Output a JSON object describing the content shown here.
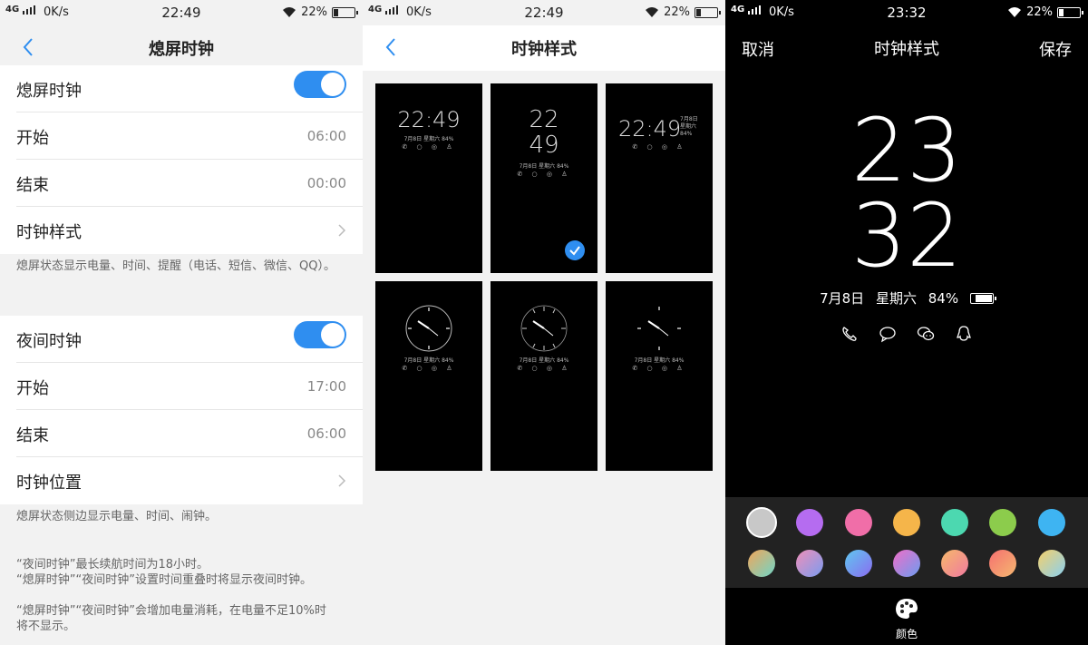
{
  "screens": [
    {
      "status": {
        "network": "4G",
        "speed": "0K/s",
        "time": "22:49",
        "battery": "22%"
      },
      "title": "熄屏时钟",
      "group1": [
        {
          "label": "熄屏时钟",
          "type": "toggle",
          "on": true
        },
        {
          "label": "开始",
          "value": "06:00"
        },
        {
          "label": "结束",
          "value": "00:00"
        },
        {
          "label": "时钟样式",
          "type": "link"
        }
      ],
      "note1": "熄屏状态显示电量、时间、提醒（电话、短信、微信、QQ）。",
      "group2": [
        {
          "label": "夜间时钟",
          "type": "toggle",
          "on": true
        },
        {
          "label": "开始",
          "value": "17:00"
        },
        {
          "label": "结束",
          "value": "06:00"
        },
        {
          "label": "时钟位置",
          "type": "link"
        }
      ],
      "note2": "熄屏状态侧边显示电量、时间、闹钟。",
      "footnotes": [
        "“夜间时钟”最长续航时间为18小时。",
        "“熄屏时钟”“夜间时钟”设置时间重叠时将显示夜间时钟。",
        "“熄屏时钟”“夜间时钟”会增加电量消耗，在电量不足10%时将不显示。"
      ]
    },
    {
      "status": {
        "network": "4G",
        "speed": "0K/s",
        "time": "22:49",
        "battery": "22%"
      },
      "title": "时钟样式",
      "thumbs": [
        {
          "style": "digital-single",
          "time": "22:49",
          "date": "7月8日  星期六",
          "battery": "84%"
        },
        {
          "style": "digital-stacked",
          "hour": "22",
          "minute": "49",
          "date": "7月8日  星期六",
          "battery": "84%",
          "selected": true
        },
        {
          "style": "digital-side",
          "time": "22:49",
          "date_side": "7月8日",
          "weekday_side": "星期六",
          "battery_side": "84%"
        },
        {
          "style": "analog",
          "date": "7月8日  星期六",
          "battery": "84%"
        },
        {
          "style": "analog-ticks",
          "date": "7月8日  星期六",
          "battery": "84%"
        },
        {
          "style": "analog-minimal",
          "date": "7月8日  星期六",
          "battery": "84%"
        }
      ]
    },
    {
      "status": {
        "network": "4G",
        "speed": "0K/s",
        "time": "23:32",
        "battery": "22%"
      },
      "title": "时钟样式",
      "cancel": "取消",
      "save": "保存",
      "hour": "23",
      "minute": "32",
      "date": "7月8日",
      "weekday": "星期六",
      "battery": "84%",
      "notif_icons": [
        "phone-icon",
        "message-icon",
        "wechat-icon",
        "qq-icon"
      ],
      "colors_row1": [
        "#c8c8c8",
        "#b56cf0",
        "#f06ea8",
        "#f5b54a",
        "#4cd8b0",
        "#8ccc4c",
        "#3eb4f2"
      ],
      "colors_row2": [
        [
          "#f2a65a",
          "#6fd6c8"
        ],
        [
          "#f08fb8",
          "#7a9cf0"
        ],
        [
          "#5fc8f0",
          "#8a6cf0"
        ],
        [
          "#f06ec8",
          "#6c9cf0"
        ],
        [
          "#f6b86a",
          "#f07aa0"
        ],
        [
          "#f57070",
          "#f5b870"
        ],
        [
          "#f5d06a",
          "#8ad0f0"
        ]
      ],
      "selected_color": 0,
      "color_label": "颜色"
    }
  ]
}
